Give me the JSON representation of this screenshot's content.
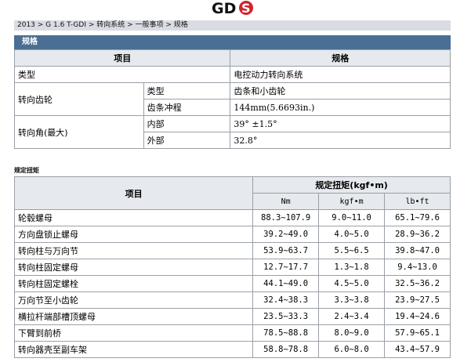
{
  "logo": {
    "text": "GDS"
  },
  "breadcrumb": "2013 > G 1.6 T-GDI > 转向系统 > 一般事项 > 规格",
  "section_title": "规格",
  "spec_table": {
    "headers": [
      "项目",
      "规格"
    ],
    "rows": {
      "type": {
        "label": "类型",
        "value": "电控动力转向系统"
      },
      "gear": {
        "label": "转向齿轮",
        "sub1": "类型",
        "val1": "齿条和小齿轮",
        "sub2": "齿条冲程",
        "val2": "144mm(5.6693in.)"
      },
      "angle": {
        "label": "转向角(最大)",
        "sub1": "内部",
        "val1": "39° ±1.5°",
        "sub2": "外部",
        "val2": "32.8°"
      }
    }
  },
  "torque_title": "规定扭矩",
  "torque_table": {
    "item_header": "项目",
    "torque_header": "规定扭矩(kgf•m)",
    "units": [
      "Nm",
      "kgf•m",
      "lb•ft"
    ],
    "rows": [
      {
        "name": "轮毂螺母",
        "nm": "88.3~107.9",
        "kgf": "9.0~11.0",
        "lbft": "65.1~79.6"
      },
      {
        "name": "方向盘锁止螺母",
        "nm": "39.2~49.0",
        "kgf": "4.0~5.0",
        "lbft": "28.9~36.2"
      },
      {
        "name": "转向柱与万向节",
        "nm": "53.9~63.7",
        "kgf": "5.5~6.5",
        "lbft": "39.8~47.0"
      },
      {
        "name": "转向柱固定螺母",
        "nm": "12.7~17.7",
        "kgf": "1.3~1.8",
        "lbft": "9.4~13.0"
      },
      {
        "name": "转向柱固定螺栓",
        "nm": "44.1~49.0",
        "kgf": "4.5~5.0",
        "lbft": "32.5~36.2"
      },
      {
        "name": "万向节至小齿轮",
        "nm": "32.4~38.3",
        "kgf": "3.3~3.8",
        "lbft": "23.9~27.5"
      },
      {
        "name": "横拉杆端部槽顶螺母",
        "nm": "23.5~33.3",
        "kgf": "2.4~3.4",
        "lbft": "19.4~24.6"
      },
      {
        "name": "下臂到前桥",
        "nm": "78.5~88.8",
        "kgf": "8.0~9.0",
        "lbft": "57.9~65.1"
      },
      {
        "name": "转向器壳至副车架",
        "nm": "58.8~78.8",
        "kgf": "6.0~8.0",
        "lbft": "43.4~57.9"
      }
    ]
  }
}
